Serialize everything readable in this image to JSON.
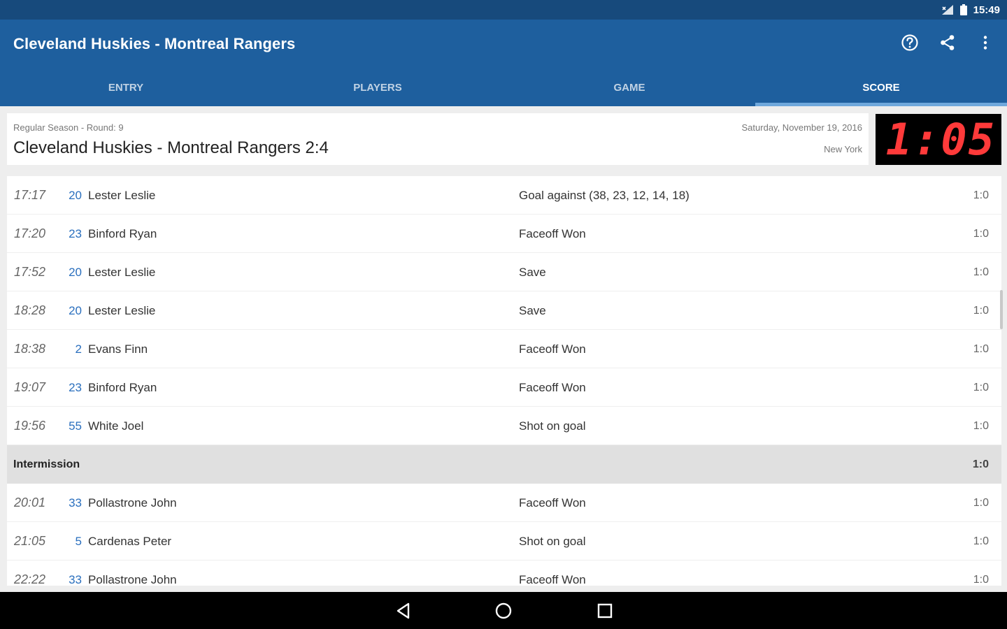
{
  "status_bar": {
    "time": "15:49"
  },
  "app_bar": {
    "title": "Cleveland Huskies - Montreal Rangers",
    "actions": [
      {
        "icon": "help-icon"
      },
      {
        "icon": "share-icon"
      },
      {
        "icon": "more-vert-icon"
      }
    ]
  },
  "tabs": [
    {
      "label": "ENTRY",
      "active": false
    },
    {
      "label": "PLAYERS",
      "active": false
    },
    {
      "label": "GAME",
      "active": false
    },
    {
      "label": "SCORE",
      "active": true
    }
  ],
  "match": {
    "meta": "Regular Season - Round: 9",
    "title": "Cleveland Huskies - Montreal Rangers 2:4",
    "date": "Saturday, November 19, 2016",
    "location": "New York",
    "clock": "1:05"
  },
  "events": [
    {
      "time": "17:17",
      "number": "20",
      "player": "Lester Leslie",
      "action": "Goal against (38, 23, 12, 14, 18)",
      "score": "1:0"
    },
    {
      "time": "17:20",
      "number": "23",
      "player": "Binford Ryan",
      "action": "Faceoff Won",
      "score": "1:0"
    },
    {
      "time": "17:52",
      "number": "20",
      "player": "Lester Leslie",
      "action": "Save",
      "score": "1:0"
    },
    {
      "time": "18:28",
      "number": "20",
      "player": "Lester Leslie",
      "action": "Save",
      "score": "1:0"
    },
    {
      "time": "18:38",
      "number": "2",
      "player": "Evans Finn",
      "action": "Faceoff Won",
      "score": "1:0"
    },
    {
      "time": "19:07",
      "number": "23",
      "player": "Binford Ryan",
      "action": "Faceoff Won",
      "score": "1:0"
    },
    {
      "time": "19:56",
      "number": "55",
      "player": "White Joel",
      "action": "Shot on goal",
      "score": "1:0"
    },
    {
      "type": "intermission",
      "label": "Intermission",
      "score": "1:0"
    },
    {
      "time": "20:01",
      "number": "33",
      "player": "Pollastrone John",
      "action": "Faceoff Won",
      "score": "1:0"
    },
    {
      "time": "21:05",
      "number": "5",
      "player": "Cardenas Peter",
      "action": "Shot on goal",
      "score": "1:0"
    },
    {
      "time": "22:22",
      "number": "33",
      "player": "Pollastrone John",
      "action": "Faceoff Won",
      "score": "1:0"
    }
  ],
  "colors": {
    "status_bar": "#174a7c",
    "app_bar": "#1e5f9e",
    "tab_indicator": "#6fa8dc",
    "clock_digits": "#ff3a3a",
    "player_number": "#2a6fbe",
    "intermission_bg": "#e0e0e0"
  }
}
